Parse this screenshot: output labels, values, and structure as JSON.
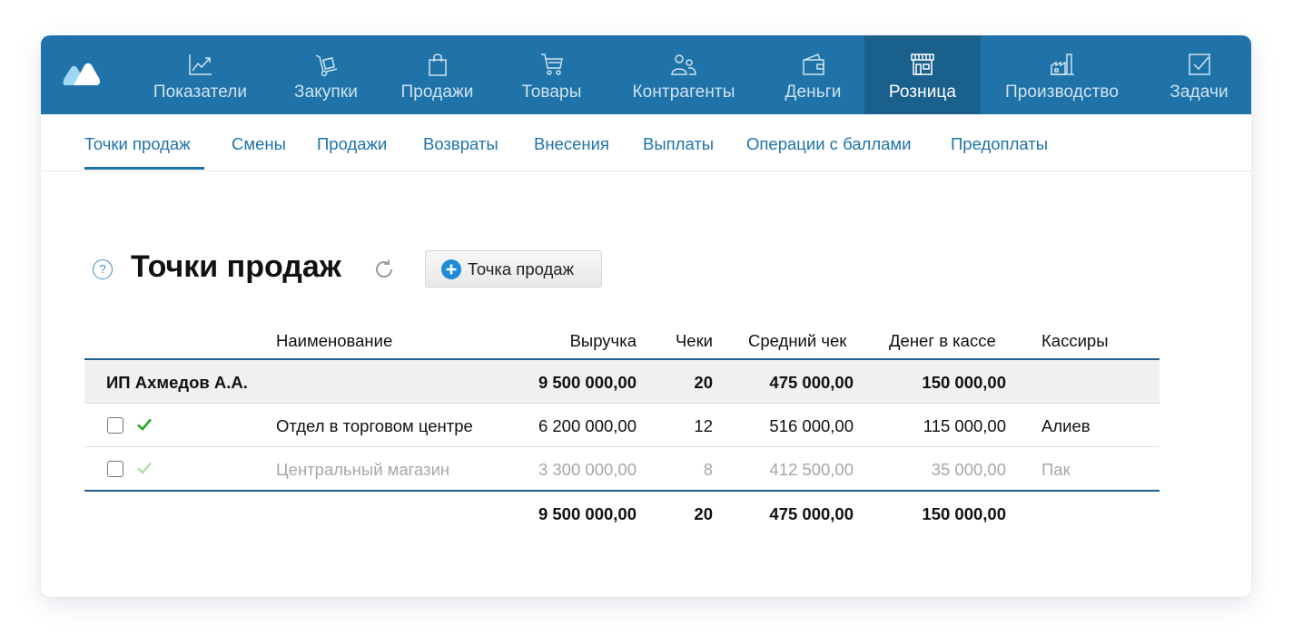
{
  "nav": {
    "items": [
      {
        "label": "Показатели",
        "icon": "chart-line-icon"
      },
      {
        "label": "Закупки",
        "icon": "hand-truck-icon"
      },
      {
        "label": "Продажи",
        "icon": "shopping-bag-icon"
      },
      {
        "label": "Товары",
        "icon": "cart-icon"
      },
      {
        "label": "Контрагенты",
        "icon": "people-icon"
      },
      {
        "label": "Деньги",
        "icon": "wallet-icon"
      },
      {
        "label": "Розница",
        "icon": "storefront-icon",
        "active": true
      },
      {
        "label": "Производство",
        "icon": "factory-icon"
      },
      {
        "label": "Задачи",
        "icon": "checkbox-icon"
      }
    ]
  },
  "subnav": {
    "items": [
      {
        "label": "Точки продаж",
        "active": true
      },
      {
        "label": "Смены"
      },
      {
        "label": "Продажи"
      },
      {
        "label": "Возвраты"
      },
      {
        "label": "Внесения"
      },
      {
        "label": "Выплаты"
      },
      {
        "label": "Операции с баллами"
      },
      {
        "label": "Предоплаты"
      }
    ]
  },
  "page": {
    "help": "?",
    "title": "Точки продаж",
    "add_button": "Точка продаж"
  },
  "table": {
    "columns": {
      "name": "Наименование",
      "revenue": "Выручка",
      "checks": "Чеки",
      "avg": "Средний чек",
      "cash": "Денег в кассе",
      "cashiers": "Кассиры"
    },
    "group": {
      "name": "ИП Ахмедов А.А.",
      "revenue": "9 500 000,00",
      "checks": "20",
      "avg": "475 000,00",
      "cash": "150 000,00"
    },
    "rows": [
      {
        "name": "Отдел в торговом центре",
        "revenue": "6 200 000,00",
        "checks": "12",
        "avg": "516 000,00",
        "cash": "115 000,00",
        "cashiers": "Алиев",
        "active": true
      },
      {
        "name": "Центральный магазин",
        "revenue": "3 300 000,00",
        "checks": "8",
        "avg": "412 500,00",
        "cash": "35 000,00",
        "cashiers": "Пак",
        "active": false
      }
    ],
    "total": {
      "revenue": "9 500 000,00",
      "checks": "20",
      "avg": "475 000,00",
      "cash": "150 000,00"
    }
  },
  "colors": {
    "brand": "#1f73a8",
    "brand_active": "#19608c",
    "check_green": "#2aa52a",
    "check_green_muted": "#a8dba8"
  }
}
